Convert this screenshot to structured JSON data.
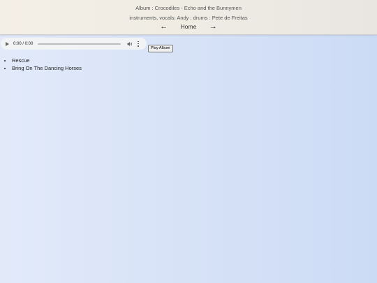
{
  "header": {
    "album_line": "Album : Crocodiles - Echo and the Bunnymen",
    "credits_line": "instruments, vocals: Andy ; drums : Pete de Freitas",
    "nav": {
      "prev_arrow": "←",
      "home_label": "Home",
      "next_arrow": "→"
    }
  },
  "player": {
    "time": "0:00 / 0:00",
    "progress_fraction": 0,
    "icons": [
      "play-icon",
      "volume-icon",
      "more-options-icon"
    ]
  },
  "play_album_label": "Play Album",
  "tracks": [
    "Rescue",
    "Bring On The Dancing Horses"
  ]
}
